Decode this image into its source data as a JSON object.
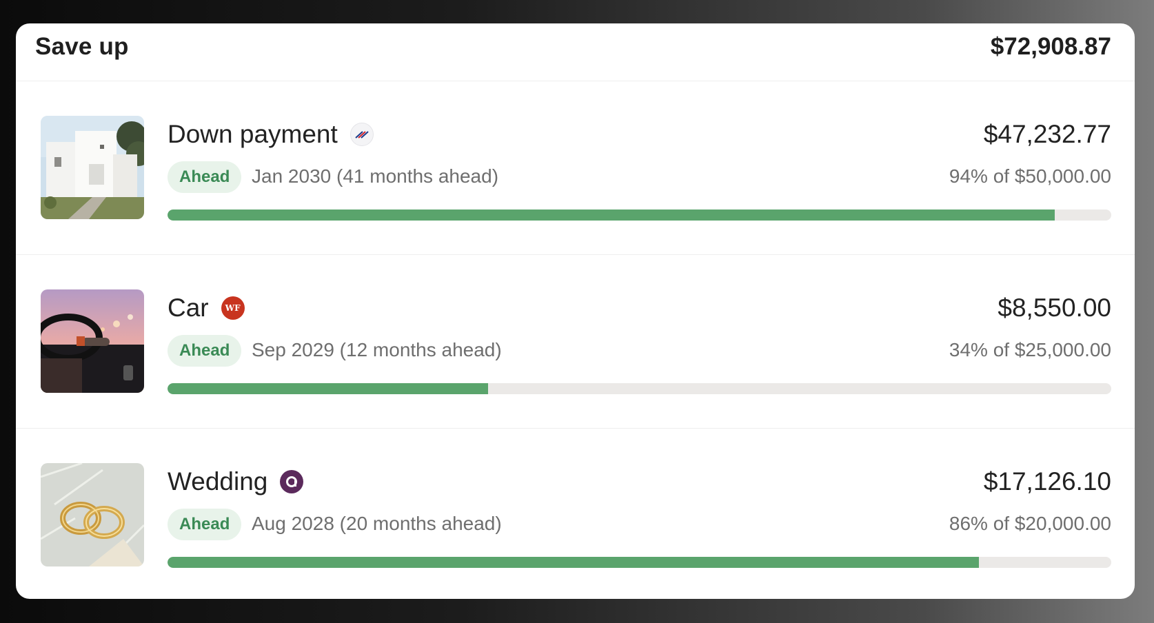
{
  "header": {
    "title": "Save up",
    "total": "$72,908.87"
  },
  "colors": {
    "accent": "#5aa46c",
    "badge_bg": "#e8f3ea",
    "badge_text": "#3a8a55",
    "track": "#ebe9e7"
  },
  "goals": [
    {
      "name": "Down payment",
      "institution_icon": "bank-of-america-icon",
      "image": "house-photo",
      "amount": "$47,232.77",
      "status": "Ahead",
      "date_text": "Jan 2030 (41 months ahead)",
      "progress_text": "94% of $50,000.00",
      "progress": 0.94
    },
    {
      "name": "Car",
      "institution_icon": "wells-fargo-icon",
      "institution_text": "WF",
      "image": "car-interior-photo",
      "amount": "$8,550.00",
      "status": "Ahead",
      "date_text": "Sep 2029 (12 months ahead)",
      "progress_text": "34% of $25,000.00",
      "progress": 0.34
    },
    {
      "name": "Wedding",
      "institution_icon": "ally-bank-icon",
      "image": "wedding-rings-photo",
      "amount": "$17,126.10",
      "status": "Ahead",
      "date_text": "Aug 2028 (20 months ahead)",
      "progress_text": "86% of $20,000.00",
      "progress": 0.86
    }
  ]
}
